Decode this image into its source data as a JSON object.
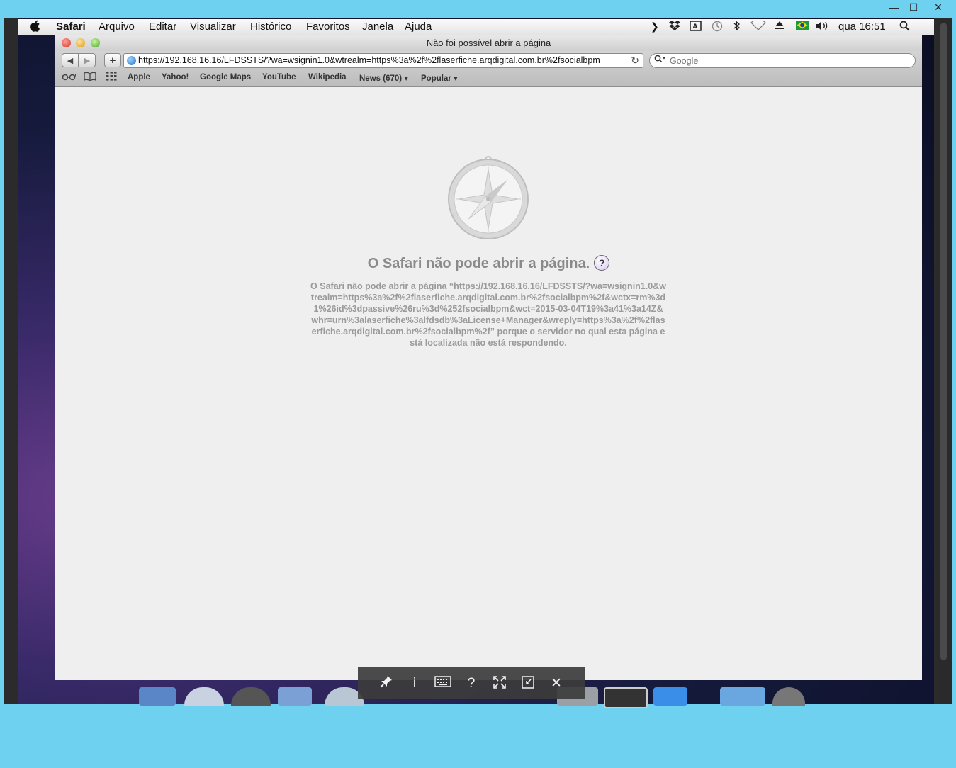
{
  "remote_window": {
    "minimize": "—",
    "maximize": "☐",
    "close": "✕"
  },
  "menubar": {
    "app": "Safari",
    "items": [
      "Arquivo",
      "Editar",
      "Visualizar",
      "Histórico",
      "Favoritos",
      "Janela",
      "Ajuda"
    ],
    "clock": "qua 16:51"
  },
  "safari": {
    "window_title": "Não foi possível abrir a página",
    "url": "https://192.168.16.16/LFDSSTS/?wa=wsignin1.0&wtrealm=https%3a%2f%2flaserfiche.arqdigital.com.br%2fsocialbpm",
    "search_placeholder": "Google",
    "bookmarks": [
      "Apple",
      "Yahoo!",
      "Google Maps",
      "YouTube",
      "Wikipedia",
      "News (670) ▾",
      "Popular ▾"
    ]
  },
  "error": {
    "title": "O Safari não pode abrir a página.",
    "help": "?",
    "message": "O Safari não pode abrir a página “https://192.168.16.16/LFDSSTS/?wa=wsignin1.0&wtrealm=https%3a%2f%2flaserfiche.arqdigital.com.br%2fsocialbpm%2f&wctx=rm%3d1%26id%3dpassive%26ru%3d%252fsocialbpm&wct=2015-03-04T19%3a41%3a14Z&whr=urn%3alaserfiche%3alfdsdb%3aLicense+Manager&wreply=https%3a%2f%2flaserfiche.arqdigital.com.br%2fsocialbpm%2f” porque o servidor no qual esta página está localizada não está respondendo."
  },
  "remote_toolbar": {
    "pin": "📌",
    "info": "i",
    "keyboard": "⌨",
    "help": "?",
    "fullscreen": "⤢",
    "fit": "⧉",
    "close": "✕"
  }
}
